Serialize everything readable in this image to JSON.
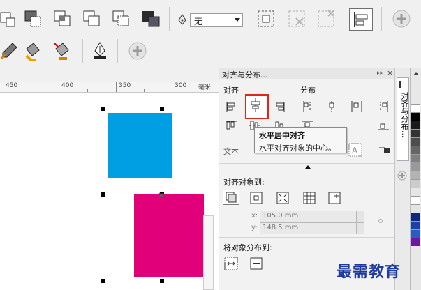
{
  "toolbar": {
    "outline_value": "无"
  },
  "ruler": {
    "labels": [
      "450",
      "400",
      "350",
      "300"
    ],
    "unit": "毫米"
  },
  "panel": {
    "title": "对齐与分布...",
    "align_label": "对齐",
    "distribute_label": "分布",
    "text_label": "文本",
    "align_to_label": "对齐对象到:",
    "x_value": "105.0 mm",
    "y_value": "148.5 mm",
    "x_label": "x:",
    "y_label": "y:",
    "distribute_to_label": "将对象分布到:"
  },
  "tooltip": {
    "title": "水平居中对齐",
    "text": "水平对齐对象的中心。"
  },
  "side_tab": {
    "label": "对齐与分布..."
  },
  "watermark": "最需教育",
  "colors": {
    "blue_rect": "#009fe3",
    "magenta_rect": "#e2007a",
    "highlight": "#e0251b"
  }
}
